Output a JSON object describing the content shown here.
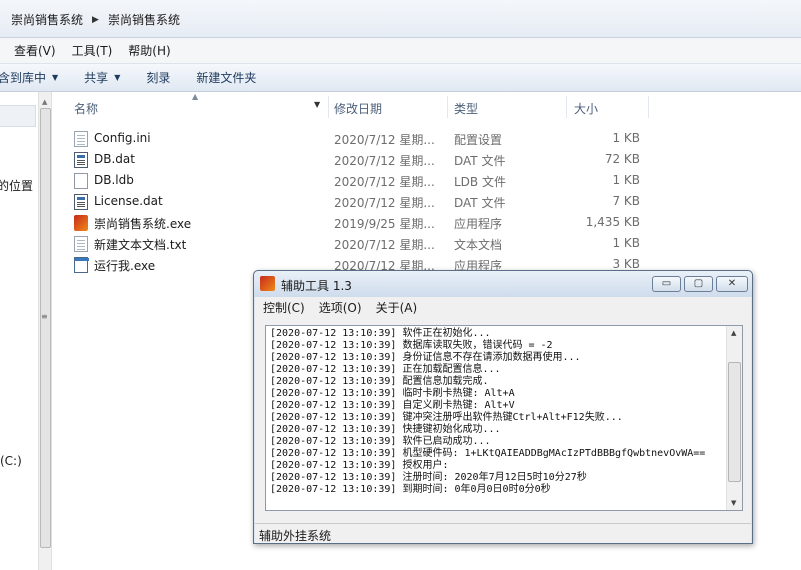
{
  "explorer": {
    "breadcrumbs": [
      "崇尚销售系统",
      "崇尚销售系统"
    ],
    "menu": [
      "查看(V)",
      "工具(T)",
      "帮助(H)"
    ],
    "commands": {
      "include_in_library": "含到库中",
      "share": "共享",
      "burn": "刻录",
      "new_folder": "新建文件夹"
    },
    "nav": {
      "location_label": "的位置",
      "drive_label": "(C:)"
    },
    "columns": {
      "name": "名称",
      "date": "修改日期",
      "type": "类型",
      "size": "大小"
    },
    "files": [
      {
        "name": "Config.ini",
        "date": "2020/7/12 星期...",
        "type": "配置设置",
        "size": "1 KB",
        "icon": "config-file-icon"
      },
      {
        "name": "DB.dat",
        "date": "2020/7/12 星期...",
        "type": "DAT 文件",
        "size": "72 KB",
        "icon": "dat-file-icon"
      },
      {
        "name": "DB.ldb",
        "date": "2020/7/12 星期...",
        "type": "LDB 文件",
        "size": "1 KB",
        "icon": "blank-file-icon"
      },
      {
        "name": "License.dat",
        "date": "2020/7/12 星期...",
        "type": "DAT 文件",
        "size": "7 KB",
        "icon": "dat-file-icon"
      },
      {
        "name": "崇尚销售系统.exe",
        "date": "2019/9/25 星期...",
        "type": "应用程序",
        "size": "1,435 KB",
        "icon": "app-exe-icon"
      },
      {
        "name": "新建文本文档.txt",
        "date": "2020/7/12 星期...",
        "type": "文本文档",
        "size": "1 KB",
        "icon": "text-file-icon"
      },
      {
        "name": "运行我.exe",
        "date": "2020/7/12 星期...",
        "type": "应用程序",
        "size": "3 KB",
        "icon": "window-exe-icon"
      }
    ]
  },
  "helper": {
    "title": "辅助工具 1.3",
    "window_buttons": {
      "minimize": "▭",
      "maximize": "▢",
      "close": "✕"
    },
    "menu": [
      "控制(C)",
      "选项(O)",
      "关于(A)"
    ],
    "log": [
      "[2020-07-12 13:10:39] 软件正在初始化...",
      "[2020-07-12 13:10:39] 数据库读取失败，错误代码 = -2",
      "[2020-07-12 13:10:39] 身份证信息不存在请添加数据再使用...",
      "[2020-07-12 13:10:39] 正在加载配置信息...",
      "[2020-07-12 13:10:39] 配置信息加载完成.",
      "[2020-07-12 13:10:39] 临时卡刷卡热键: Alt+A",
      "[2020-07-12 13:10:39] 自定义刷卡热键: Alt+V",
      "[2020-07-12 13:10:39] 键冲突注册呼出软件热键Ctrl+Alt+F12失败...",
      "[2020-07-12 13:10:39] 快捷键初始化成功...",
      "[2020-07-12 13:10:39] 软件已启动成功...",
      "[2020-07-12 13:10:39] 机型硬件码: 1+LKtQAIEADDBgMAcIzPTdBBBgfQwbtnevOvWA==",
      "[2020-07-12 13:10:39] 授权用户:",
      "[2020-07-12 13:10:39] 注册时间: 2020年7月12日5时10分27秒",
      "[2020-07-12 13:10:39] 到期时间: 0年0月0日0时0分0秒"
    ],
    "status": "辅助外挂系统"
  }
}
